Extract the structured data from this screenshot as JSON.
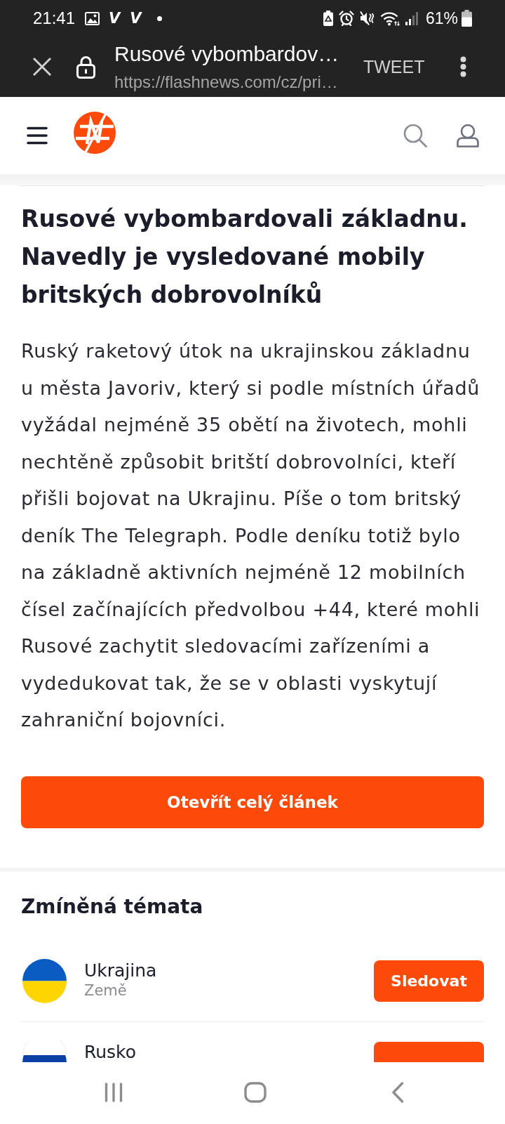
{
  "status_bar": {
    "time": "21:41",
    "notification_marks": [
      "V",
      "V"
    ],
    "battery": "61%"
  },
  "browser_toolbar": {
    "title": "Rusové vybombardov…",
    "url": "https://flashnews.com/cz/pri…",
    "action": "TWEET"
  },
  "article": {
    "headline": "Rusové vybombardovali základnu. Navedly je vysledované mobily britských dobrovolníků",
    "body": "Ruský raketový útok na ukrajinskou základnu u města Javoriv, který si podle místních úřadů vyžádal nejméně 35 obětí na životech, mohli nechtěně způsobit britští dobrovolníci, kteří přišli bojovat na Ukrajinu. Píše o tom britský deník The Telegraph. Podle deníku totiž bylo na základně aktivních nejméně 12 mobilních čísel začínajících předvolbou +44, které mohli Rusové zachytit sledovacími zařízeními a vydedukovat tak, že se v oblasti vyskytují zahraniční bojovníci.",
    "open_button": "Otevřít celý článek"
  },
  "topics": {
    "title": "Zmíněná témata",
    "items": [
      {
        "kind": "ukraine",
        "name": "Ukrajina",
        "category": "Země",
        "button": "Sledovat"
      },
      {
        "kind": "russia",
        "name": "Rusko"
      }
    ]
  }
}
